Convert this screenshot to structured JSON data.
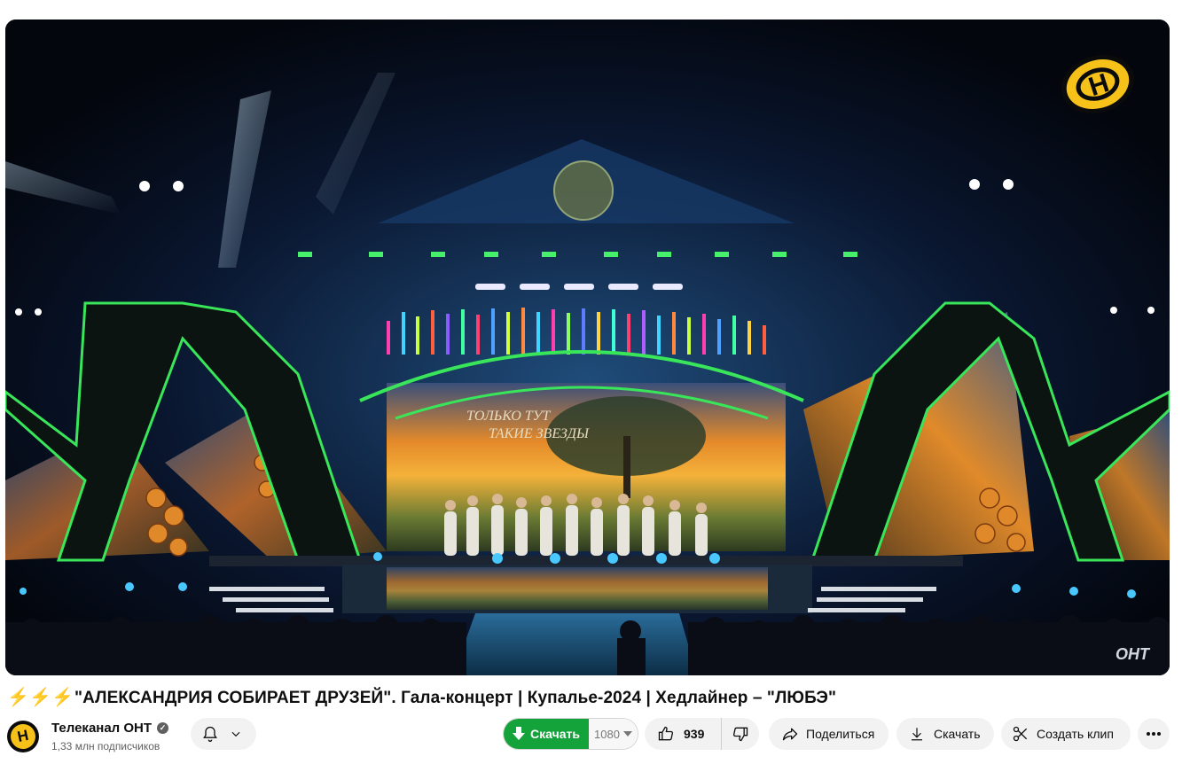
{
  "video": {
    "channel_logo_text": "H",
    "watermark": "ОНТ",
    "stage_text_line1": "ТОЛЬКО ТУТ",
    "stage_text_line2": "ТАКИЕ ЗВЕЗДЫ"
  },
  "title": {
    "bolts": "⚡⚡⚡",
    "text": "\"АЛЕКСАНДРИЯ СОБИРАЕТ ДРУЗЕЙ\". Гала-концерт | Купалье-2024 | Хедлайнер – \"ЛЮБЭ\""
  },
  "channel": {
    "avatar_letter": "H",
    "name": "Телеканал ОНТ",
    "subscribers": "1,33 млн подписчиков"
  },
  "actions": {
    "download_ext_label": "Скачать",
    "quality": "1080",
    "likes": "939",
    "share_label": "Поделиться",
    "download_label": "Скачать",
    "clip_label": "Создать клип"
  },
  "colors": {
    "logo_yellow": "#f6c21a",
    "download_green": "#14a23a",
    "neon_green": "#39e65a"
  }
}
